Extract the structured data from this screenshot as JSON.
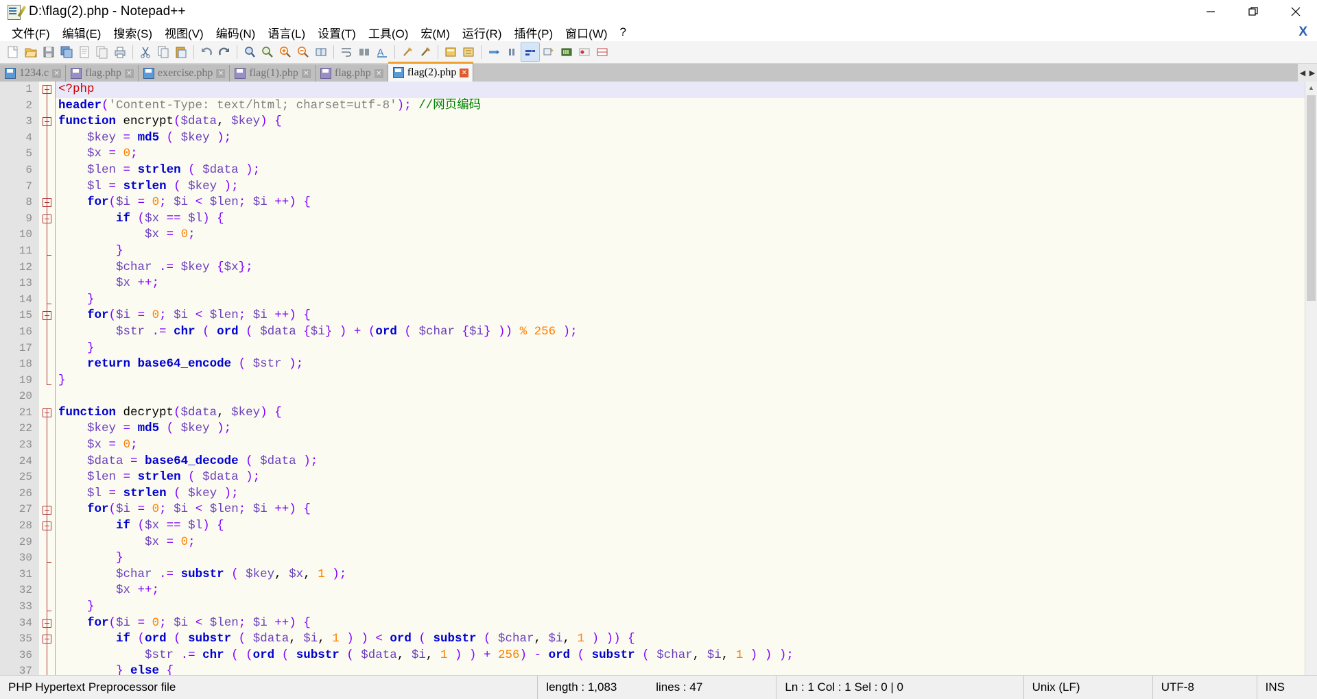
{
  "window": {
    "title": "D:\\flag(2).php - Notepad++",
    "icon": "notepad-plus-plus-icon",
    "controls": [
      {
        "name": "minimize-button",
        "glyph": "minimize-icon"
      },
      {
        "name": "maximize-button",
        "glyph": "maximize-icon"
      },
      {
        "name": "close-button",
        "glyph": "close-icon"
      }
    ]
  },
  "menubar": {
    "items": [
      {
        "label": "文件(F)",
        "name": "menu-file"
      },
      {
        "label": "编辑(E)",
        "name": "menu-edit"
      },
      {
        "label": "搜索(S)",
        "name": "menu-search"
      },
      {
        "label": "视图(V)",
        "name": "menu-view"
      },
      {
        "label": "编码(N)",
        "name": "menu-encoding"
      },
      {
        "label": "语言(L)",
        "name": "menu-language"
      },
      {
        "label": "设置(T)",
        "name": "menu-settings"
      },
      {
        "label": "工具(O)",
        "name": "menu-tools"
      },
      {
        "label": "宏(M)",
        "name": "menu-macro"
      },
      {
        "label": "运行(R)",
        "name": "menu-run"
      },
      {
        "label": "插件(P)",
        "name": "menu-plugins"
      },
      {
        "label": "窗口(W)",
        "name": "menu-window"
      },
      {
        "label": "?",
        "name": "menu-help"
      }
    ],
    "close_doc_label": "X"
  },
  "toolbar": {
    "buttons": [
      "new-file-icon",
      "open-file-icon",
      "save-icon",
      "save-all-icon",
      "close-file-icon",
      "close-all-icon",
      "print-icon",
      "cut-icon",
      "copy-icon",
      "paste-icon",
      "undo-icon",
      "redo-icon",
      "find-icon",
      "replace-icon",
      "zoom-in-icon",
      "zoom-out-icon",
      "sync-vertical-icon",
      "sync-horizontal-icon",
      "word-wrap-icon",
      "show-all-chars-icon",
      "indent-guide-icon",
      "ui-layout-icon",
      "user-define-dialog-icon",
      "document-map-icon",
      "function-list-icon",
      "folder-as-workspace-icon",
      "record-macro-icon",
      "stop-macro-icon",
      "play-macro-icon",
      "fast-play-macro-icon",
      "save-macro-icon"
    ]
  },
  "tabs": [
    {
      "label": "1234.c",
      "name": "tab-1234-c",
      "active": false,
      "icon": "saved-file-icon",
      "color": "blue"
    },
    {
      "label": "flag.php",
      "name": "tab-flag-php-1",
      "active": false,
      "icon": "saved-file-icon",
      "color": "purple"
    },
    {
      "label": "exercise.php",
      "name": "tab-exercise-php",
      "active": false,
      "icon": "saved-file-icon",
      "color": "blue"
    },
    {
      "label": "flag(1).php",
      "name": "tab-flag-1-php",
      "active": false,
      "icon": "saved-file-icon",
      "color": "purple"
    },
    {
      "label": "flag.php",
      "name": "tab-flag-php-2",
      "active": false,
      "icon": "saved-file-icon",
      "color": "purple"
    },
    {
      "label": "flag(2).php",
      "name": "tab-flag-2-php",
      "active": true,
      "icon": "saved-file-icon",
      "color": "blue"
    }
  ],
  "tab_scroll": {
    "left": "◀",
    "right": "▶"
  },
  "editor": {
    "first_line": 1,
    "total_visible_lines": 37,
    "caret_line": 1,
    "lines": [
      {
        "n": 1,
        "fold": "open",
        "html": "<span class='tag'>&lt;?php</span>"
      },
      {
        "n": 2,
        "fold": "",
        "html": "<span class='fn'>header</span><span class='op'>(</span><span class='str'>'Content-Type: text/html; charset=utf-8'</span><span class='op'>);</span> <span class='cmt'>//网页编码</span>"
      },
      {
        "n": 3,
        "fold": "open",
        "html": "<span class='kw'>function</span> encrypt<span class='op'>(</span><span class='var'>$data</span>, <span class='var'>$key</span><span class='op'>)</span> <span class='op'>{</span>"
      },
      {
        "n": 4,
        "fold": "",
        "html": "    <span class='var'>$key</span> <span class='op'>=</span> <span class='fn'>md5</span> <span class='op'>(</span> <span class='var'>$key</span> <span class='op'>);</span>"
      },
      {
        "n": 5,
        "fold": "",
        "html": "    <span class='var'>$x</span> <span class='op'>=</span> <span class='num'>0</span><span class='op'>;</span>"
      },
      {
        "n": 6,
        "fold": "",
        "html": "    <span class='var'>$len</span> <span class='op'>=</span> <span class='fn'>strlen</span> <span class='op'>(</span> <span class='var'>$data</span> <span class='op'>);</span>"
      },
      {
        "n": 7,
        "fold": "",
        "html": "    <span class='var'>$l</span> <span class='op'>=</span> <span class='fn'>strlen</span> <span class='op'>(</span> <span class='var'>$key</span> <span class='op'>);</span>"
      },
      {
        "n": 8,
        "fold": "open",
        "html": "    <span class='kw'>for</span><span class='op'>(</span><span class='var'>$i</span> <span class='op'>=</span> <span class='num'>0</span><span class='op'>;</span> <span class='var'>$i</span> <span class='op'>&lt;</span> <span class='var'>$len</span><span class='op'>;</span> <span class='var'>$i</span> <span class='op'>++)</span> <span class='op'>{</span>"
      },
      {
        "n": 9,
        "fold": "open",
        "html": "        <span class='kw'>if</span> <span class='op'>(</span><span class='var'>$x</span> <span class='op'>==</span> <span class='var'>$l</span><span class='op'>)</span> <span class='op'>{</span>"
      },
      {
        "n": 10,
        "fold": "",
        "html": "            <span class='var'>$x</span> <span class='op'>=</span> <span class='num'>0</span><span class='op'>;</span>"
      },
      {
        "n": 11,
        "fold": "tick",
        "html": "        <span class='op'>}</span>"
      },
      {
        "n": 12,
        "fold": "",
        "html": "        <span class='var'>$char</span> <span class='op'>.=</span> <span class='var'>$key</span> <span class='op'>{</span><span class='var'>$x</span><span class='op'>};</span>"
      },
      {
        "n": 13,
        "fold": "",
        "html": "        <span class='var'>$x</span> <span class='op'>++;</span>"
      },
      {
        "n": 14,
        "fold": "tick",
        "html": "    <span class='op'>}</span>"
      },
      {
        "n": 15,
        "fold": "open",
        "html": "    <span class='kw'>for</span><span class='op'>(</span><span class='var'>$i</span> <span class='op'>=</span> <span class='num'>0</span><span class='op'>;</span> <span class='var'>$i</span> <span class='op'>&lt;</span> <span class='var'>$len</span><span class='op'>;</span> <span class='var'>$i</span> <span class='op'>++)</span> <span class='op'>{</span>"
      },
      {
        "n": 16,
        "fold": "",
        "html": "        <span class='var'>$str</span> <span class='op'>.=</span> <span class='fn'>chr</span> <span class='op'>(</span> <span class='fn'>ord</span> <span class='op'>(</span> <span class='var'>$data</span> <span class='op'>{</span><span class='var'>$i</span><span class='op'>}</span> <span class='op'>)</span> <span class='op'>+</span> <span class='op'>(</span><span class='fn'>ord</span> <span class='op'>(</span> <span class='var'>$char</span> <span class='op'>{</span><span class='var'>$i</span><span class='op'>}</span> <span class='op'>))</span> <span class='pct'>%</span> <span class='num'>256</span> <span class='op'>);</span>"
      },
      {
        "n": 17,
        "fold": "",
        "html": "    <span class='op'>}</span>"
      },
      {
        "n": 18,
        "fold": "",
        "html": "    <span class='kw'>return</span> <span class='fn'>base64_encode</span> <span class='op'>(</span> <span class='var'>$str</span> <span class='op'>);</span>"
      },
      {
        "n": 19,
        "fold": "tick",
        "html": "<span class='op'>}</span>"
      },
      {
        "n": 20,
        "fold": "",
        "html": ""
      },
      {
        "n": 21,
        "fold": "open",
        "html": "<span class='kw'>function</span> decrypt<span class='op'>(</span><span class='var'>$data</span>, <span class='var'>$key</span><span class='op'>)</span> <span class='op'>{</span>"
      },
      {
        "n": 22,
        "fold": "",
        "html": "    <span class='var'>$key</span> <span class='op'>=</span> <span class='fn'>md5</span> <span class='op'>(</span> <span class='var'>$key</span> <span class='op'>);</span>"
      },
      {
        "n": 23,
        "fold": "",
        "html": "    <span class='var'>$x</span> <span class='op'>=</span> <span class='num'>0</span><span class='op'>;</span>"
      },
      {
        "n": 24,
        "fold": "",
        "html": "    <span class='var'>$data</span> <span class='op'>=</span> <span class='fn'>base64_decode</span> <span class='op'>(</span> <span class='var'>$data</span> <span class='op'>);</span>"
      },
      {
        "n": 25,
        "fold": "",
        "html": "    <span class='var'>$len</span> <span class='op'>=</span> <span class='fn'>strlen</span> <span class='op'>(</span> <span class='var'>$data</span> <span class='op'>);</span>"
      },
      {
        "n": 26,
        "fold": "",
        "html": "    <span class='var'>$l</span> <span class='op'>=</span> <span class='fn'>strlen</span> <span class='op'>(</span> <span class='var'>$key</span> <span class='op'>);</span>"
      },
      {
        "n": 27,
        "fold": "open",
        "html": "    <span class='kw'>for</span><span class='op'>(</span><span class='var'>$i</span> <span class='op'>=</span> <span class='num'>0</span><span class='op'>;</span> <span class='var'>$i</span> <span class='op'>&lt;</span> <span class='var'>$len</span><span class='op'>;</span> <span class='var'>$i</span> <span class='op'>++)</span> <span class='op'>{</span>"
      },
      {
        "n": 28,
        "fold": "open",
        "html": "        <span class='kw'>if</span> <span class='op'>(</span><span class='var'>$x</span> <span class='op'>==</span> <span class='var'>$l</span><span class='op'>)</span> <span class='op'>{</span>"
      },
      {
        "n": 29,
        "fold": "",
        "html": "            <span class='var'>$x</span> <span class='op'>=</span> <span class='num'>0</span><span class='op'>;</span>"
      },
      {
        "n": 30,
        "fold": "tick",
        "html": "        <span class='op'>}</span>"
      },
      {
        "n": 31,
        "fold": "",
        "html": "        <span class='var'>$char</span> <span class='op'>.=</span> <span class='fn'>substr</span> <span class='op'>(</span> <span class='var'>$key</span>, <span class='var'>$x</span>, <span class='num'>1</span> <span class='op'>);</span>"
      },
      {
        "n": 32,
        "fold": "",
        "html": "        <span class='var'>$x</span> <span class='op'>++;</span>"
      },
      {
        "n": 33,
        "fold": "tick",
        "html": "    <span class='op'>}</span>"
      },
      {
        "n": 34,
        "fold": "open",
        "html": "    <span class='kw'>for</span><span class='op'>(</span><span class='var'>$i</span> <span class='op'>=</span> <span class='num'>0</span><span class='op'>;</span> <span class='var'>$i</span> <span class='op'>&lt;</span> <span class='var'>$len</span><span class='op'>;</span> <span class='var'>$i</span> <span class='op'>++)</span> <span class='op'>{</span>"
      },
      {
        "n": 35,
        "fold": "open",
        "html": "        <span class='kw'>if</span> <span class='op'>(</span><span class='fn'>ord</span> <span class='op'>(</span> <span class='fn'>substr</span> <span class='op'>(</span> <span class='var'>$data</span>, <span class='var'>$i</span>, <span class='num'>1</span> <span class='op'>)</span> <span class='op'>)</span> <span class='op'>&lt;</span> <span class='fn'>ord</span> <span class='op'>(</span> <span class='fn'>substr</span> <span class='op'>(</span> <span class='var'>$char</span>, <span class='var'>$i</span>, <span class='num'>1</span> <span class='op'>)</span> <span class='op'>))</span> <span class='op'>{</span>"
      },
      {
        "n": 36,
        "fold": "",
        "html": "            <span class='var'>$str</span> <span class='op'>.=</span> <span class='fn'>chr</span> <span class='op'>(</span> <span class='op'>(</span><span class='fn'>ord</span> <span class='op'>(</span> <span class='fn'>substr</span> <span class='op'>(</span> <span class='var'>$data</span>, <span class='var'>$i</span>, <span class='num'>1</span> <span class='op'>)</span> <span class='op'>)</span> <span class='op'>+</span> <span class='num'>256</span><span class='op'>)</span> <span class='op'>-</span> <span class='fn'>ord</span> <span class='op'>(</span> <span class='fn'>substr</span> <span class='op'>(</span> <span class='var'>$char</span>, <span class='var'>$i</span>, <span class='num'>1</span> <span class='op'>)</span> <span class='op'>)</span> <span class='op'>);</span>"
      },
      {
        "n": 37,
        "fold": "",
        "html": "        <span class='op'>}</span> <span class='kw'>else</span> <span class='op'>{</span>"
      }
    ]
  },
  "statusbar": {
    "doc_type": "PHP Hypertext Preprocessor file",
    "length_label": "length : 1,083",
    "lines_label": "lines : 47",
    "position_label": "Ln : 1    Col : 1    Sel : 0 | 0",
    "eol": "Unix (LF)",
    "encoding": "UTF-8",
    "insert_mode": "INS"
  },
  "scrollbar": {
    "up": "▲",
    "down": "▼"
  }
}
